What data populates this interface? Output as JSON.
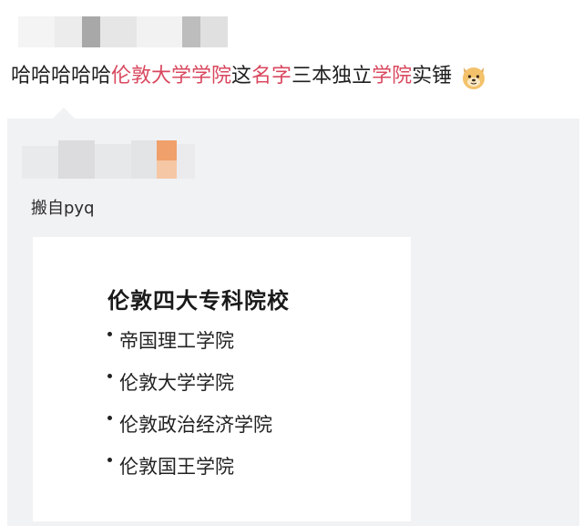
{
  "post": {
    "segments": [
      {
        "text": "哈哈哈哈哈",
        "color": "#1f1f1f"
      },
      {
        "text": "伦敦大学学院",
        "color": "#d9485f"
      },
      {
        "text": "这",
        "color": "#1f1f1f"
      },
      {
        "text": "名字",
        "color": "#d9485f"
      },
      {
        "text": "三本独立",
        "color": "#1f1f1f"
      },
      {
        "text": "学院",
        "color": "#d9485f"
      },
      {
        "text": "实锤",
        "color": "#1f1f1f"
      }
    ],
    "emoji": "dog-face-icon"
  },
  "repost": {
    "source": "搬自pyq",
    "card": {
      "title": "伦敦四大专科院校",
      "items": [
        "帝国理工学院",
        "伦敦大学学院",
        "伦敦政治经济学院",
        "伦敦国王学院"
      ]
    }
  },
  "colors": {
    "highlight": "#d9485f",
    "panel_bg": "#f1f2f4",
    "blur_orange": "#f0a06a"
  }
}
